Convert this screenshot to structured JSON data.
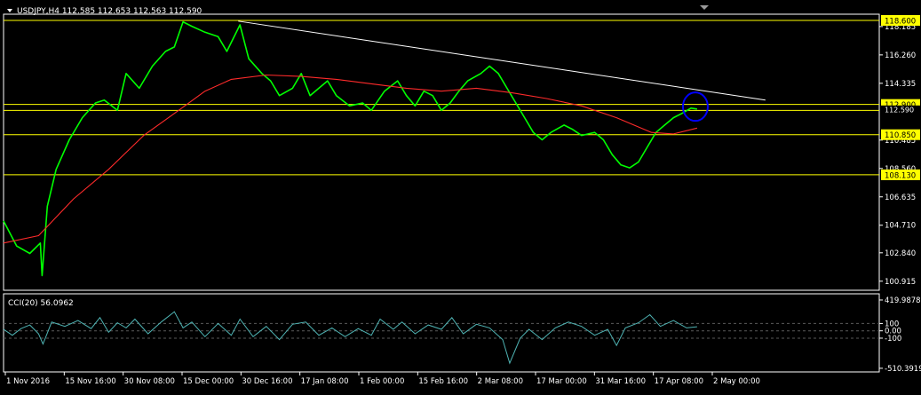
{
  "chart_data": [
    {
      "type": "line",
      "title": "USDJPY,H4  112.585 112.653 112.563 112.590",
      "symbol": "USDJPY",
      "timeframe": "H4",
      "ohlc": {
        "open": 112.585,
        "high": 112.653,
        "low": 112.563,
        "close": 112.59
      },
      "ylim": [
        100.3,
        118.9
      ],
      "y_ticks": [
        118.185,
        116.26,
        114.335,
        110.485,
        108.56,
        106.635,
        104.71,
        102.84,
        100.915
      ],
      "x_ticks": [
        "1 Nov 2016",
        "15 Nov 16:00",
        "30 Nov 08:00",
        "15 Dec 00:00",
        "30 Dec 16:00",
        "17 Jan 08:00",
        "1 Feb 00:00",
        "15 Feb 16:00",
        "2 Mar 08:00",
        "17 Mar 00:00",
        "31 Mar 16:00",
        "17 Apr 08:00",
        "2 May 00:00"
      ],
      "x_range": [
        0,
        1000
      ],
      "series": [
        {
          "name": "",
          "color": "#00ff00",
          "points": [
            [
              0,
              105.0
            ],
            [
              15,
              103.3
            ],
            [
              30,
              102.8
            ],
            [
              42,
              103.5
            ],
            [
              44,
              101.3
            ],
            [
              50,
              106.0
            ],
            [
              60,
              108.5
            ],
            [
              75,
              110.5
            ],
            [
              90,
              112.0
            ],
            [
              105,
              113.0
            ],
            [
              115,
              113.2
            ],
            [
              130,
              112.5
            ],
            [
              140,
              115.0
            ],
            [
              155,
              114.0
            ],
            [
              170,
              115.5
            ],
            [
              185,
              116.5
            ],
            [
              195,
              116.8
            ],
            [
              205,
              118.5
            ],
            [
              215,
              118.2
            ],
            [
              230,
              117.8
            ],
            [
              245,
              117.5
            ],
            [
              255,
              116.5
            ],
            [
              270,
              118.3
            ],
            [
              280,
              116.0
            ],
            [
              295,
              115.0
            ],
            [
              305,
              114.5
            ],
            [
              315,
              113.5
            ],
            [
              330,
              114.0
            ],
            [
              340,
              115.0
            ],
            [
              350,
              113.5
            ],
            [
              360,
              114.0
            ],
            [
              370,
              114.5
            ],
            [
              380,
              113.5
            ],
            [
              395,
              112.8
            ],
            [
              410,
              113.0
            ],
            [
              420,
              112.5
            ],
            [
              435,
              113.8
            ],
            [
              450,
              114.5
            ],
            [
              460,
              113.5
            ],
            [
              470,
              112.8
            ],
            [
              480,
              113.8
            ],
            [
              490,
              113.5
            ],
            [
              500,
              112.5
            ],
            [
              510,
              113.0
            ],
            [
              520,
              113.8
            ],
            [
              530,
              114.5
            ],
            [
              545,
              115.0
            ],
            [
              555,
              115.5
            ],
            [
              565,
              115.0
            ],
            [
              575,
              114.0
            ],
            [
              585,
              113.0
            ],
            [
              595,
              112.0
            ],
            [
              605,
              111.0
            ],
            [
              615,
              110.5
            ],
            [
              625,
              111.0
            ],
            [
              640,
              111.5
            ],
            [
              650,
              111.2
            ],
            [
              660,
              110.8
            ],
            [
              675,
              111.0
            ],
            [
              685,
              110.5
            ],
            [
              695,
              109.5
            ],
            [
              705,
              108.8
            ],
            [
              715,
              108.6
            ],
            [
              725,
              109.0
            ],
            [
              735,
              110.0
            ],
            [
              745,
              111.0
            ],
            [
              755,
              111.5
            ],
            [
              765,
              112.0
            ],
            [
              775,
              112.3
            ],
            [
              785,
              112.65
            ],
            [
              792,
              112.59
            ]
          ]
        },
        {
          "name": "",
          "color": "#ff2b2b",
          "points": [
            [
              0,
              103.5
            ],
            [
              40,
              104.0
            ],
            [
              80,
              106.5
            ],
            [
              120,
              108.5
            ],
            [
              160,
              110.8
            ],
            [
              200,
              112.5
            ],
            [
              230,
              113.8
            ],
            [
              260,
              114.6
            ],
            [
              300,
              114.9
            ],
            [
              340,
              114.8
            ],
            [
              380,
              114.6
            ],
            [
              420,
              114.3
            ],
            [
              460,
              114.0
            ],
            [
              500,
              113.8
            ],
            [
              540,
              114.0
            ],
            [
              580,
              113.7
            ],
            [
              620,
              113.3
            ],
            [
              660,
              112.8
            ],
            [
              700,
              112.0
            ],
            [
              740,
              111.0
            ],
            [
              765,
              110.9
            ],
            [
              792,
              111.3
            ]
          ]
        }
      ],
      "trendline": {
        "color": "#ffffff",
        "points": [
          [
            268,
            118.55
          ],
          [
            870,
            113.2
          ]
        ]
      },
      "horizontal_levels": [
        {
          "value": 118.6,
          "label": "118.600",
          "color": "#ffff00"
        },
        {
          "value": 112.9,
          "label": "112.900",
          "color": "#ffff00"
        },
        {
          "value": 112.5,
          "label": "",
          "color": "#ffff00"
        },
        {
          "value": 110.85,
          "label": "110.850",
          "color": "#ffff00"
        },
        {
          "value": 108.13,
          "label": "108.130",
          "color": "#ffff00"
        }
      ],
      "current_price_label": "112.590",
      "highlight_circle": {
        "x": 790,
        "y": 112.75,
        "color": "#0000ff"
      }
    },
    {
      "type": "line",
      "title": "CCI(20) 56.0962",
      "indicator": "CCI(20)",
      "current_value": 56.0962,
      "ylim": [
        -560,
        480
      ],
      "y_ticks": [
        419.9878,
        100,
        0,
        -100,
        -510.3919
      ],
      "y_tick_labels": [
        "419.9878",
        "100",
        "0.00",
        "-100",
        "-510.3919"
      ],
      "levels": [
        100,
        0,
        -100
      ],
      "series": [
        {
          "name": "",
          "color": "#4fb4b4",
          "points": [
            [
              0,
              20
            ],
            [
              10,
              -60
            ],
            [
              20,
              30
            ],
            [
              30,
              80
            ],
            [
              40,
              -40
            ],
            [
              45,
              -180
            ],
            [
              55,
              120
            ],
            [
              70,
              60
            ],
            [
              85,
              140
            ],
            [
              100,
              30
            ],
            [
              110,
              180
            ],
            [
              120,
              -20
            ],
            [
              130,
              110
            ],
            [
              140,
              40
            ],
            [
              150,
              160
            ],
            [
              165,
              -40
            ],
            [
              180,
              120
            ],
            [
              195,
              260
            ],
            [
              205,
              40
            ],
            [
              215,
              120
            ],
            [
              230,
              -80
            ],
            [
              245,
              100
            ],
            [
              260,
              -60
            ],
            [
              270,
              160
            ],
            [
              285,
              -80
            ],
            [
              300,
              60
            ],
            [
              315,
              -120
            ],
            [
              330,
              90
            ],
            [
              345,
              120
            ],
            [
              360,
              -60
            ],
            [
              375,
              40
            ],
            [
              390,
              -80
            ],
            [
              405,
              30
            ],
            [
              420,
              -60
            ],
            [
              430,
              160
            ],
            [
              445,
              20
            ],
            [
              455,
              120
            ],
            [
              470,
              -40
            ],
            [
              485,
              80
            ],
            [
              500,
              20
            ],
            [
              512,
              180
            ],
            [
              525,
              -40
            ],
            [
              540,
              90
            ],
            [
              555,
              40
            ],
            [
              570,
              -120
            ],
            [
              578,
              -440
            ],
            [
              590,
              -100
            ],
            [
              600,
              20
            ],
            [
              615,
              -120
            ],
            [
              630,
              40
            ],
            [
              645,
              120
            ],
            [
              660,
              60
            ],
            [
              675,
              -60
            ],
            [
              690,
              20
            ],
            [
              700,
              -200
            ],
            [
              710,
              40
            ],
            [
              725,
              110
            ],
            [
              738,
              220
            ],
            [
              750,
              60
            ],
            [
              765,
              140
            ],
            [
              780,
              40
            ],
            [
              792,
              56
            ]
          ]
        }
      ]
    }
  ],
  "x_axis_labels": [
    "1 Nov 2016",
    "15 Nov 16:00",
    "30 Nov 08:00",
    "15 Dec 00:00",
    "30 Dec 16:00",
    "17 Jan 08:00",
    "1 Feb 00:00",
    "15 Feb 16:00",
    "2 Mar 08:00",
    "17 Mar 00:00",
    "31 Mar 16:00",
    "17 Apr 08:00",
    "2 May 00:00"
  ],
  "colors": {
    "background": "#000000",
    "axis": "#ffffff",
    "grid": "#5a5a5a",
    "price": "#00ff00",
    "ma": "#ff2b2b",
    "level": "#ffff00",
    "cci": "#4fb4b4",
    "circle": "#0000ff"
  },
  "header": {
    "collapse_icon": "triangle-down-icon"
  }
}
